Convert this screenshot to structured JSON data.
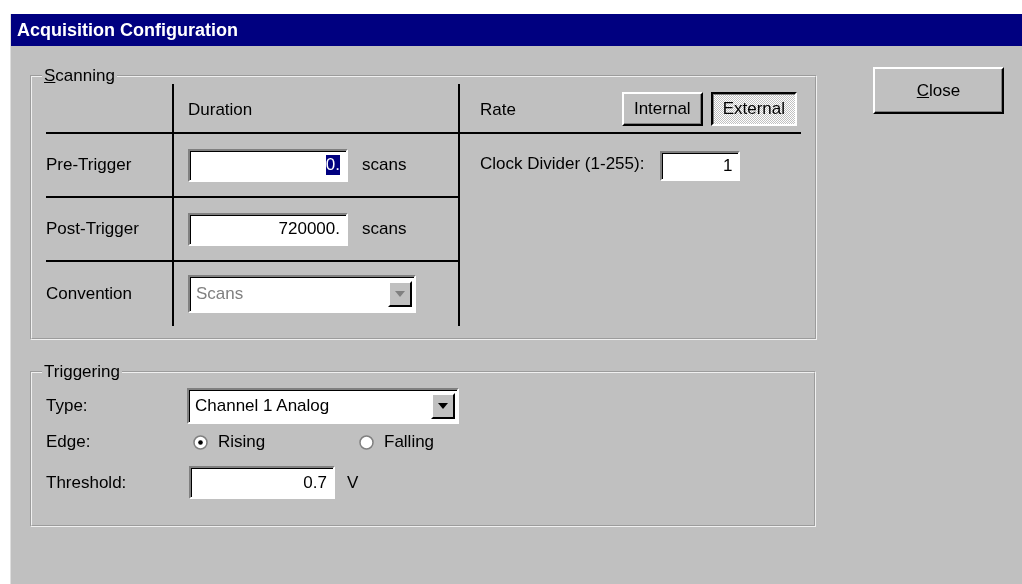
{
  "window": {
    "title": "Acquisition Configuration"
  },
  "scanning": {
    "title": "Scanning",
    "headers": {
      "duration": "Duration",
      "rate": "Rate"
    },
    "rows": [
      {
        "label": "Pre-Trigger",
        "kind": "number",
        "value": "0.",
        "unit": "scans",
        "highlighted": true
      },
      {
        "label": "Post-Trigger",
        "kind": "number",
        "value": "720000.",
        "unit": "scans",
        "highlighted": false
      },
      {
        "label": "Convention",
        "kind": "dropdown",
        "value": "Scans",
        "disabled": true
      }
    ],
    "rate_modes": [
      {
        "label": "Internal",
        "selected": false
      },
      {
        "label": "External",
        "selected": true
      }
    ],
    "clock_divider": {
      "label": "Clock Divider (1-255):",
      "value": "1"
    }
  },
  "triggering": {
    "title": "Triggering",
    "type": {
      "label": "Type:",
      "value": "Channel 1 Analog",
      "disabled": false
    },
    "edge": {
      "label": "Edge:",
      "options": [
        {
          "label": "Rising",
          "selected": true
        },
        {
          "label": "Falling",
          "selected": false
        }
      ]
    },
    "threshold": {
      "label": "Threshold:",
      "value": "0.7",
      "unit": "V"
    }
  },
  "buttons": [
    {
      "label": "Close"
    }
  ]
}
